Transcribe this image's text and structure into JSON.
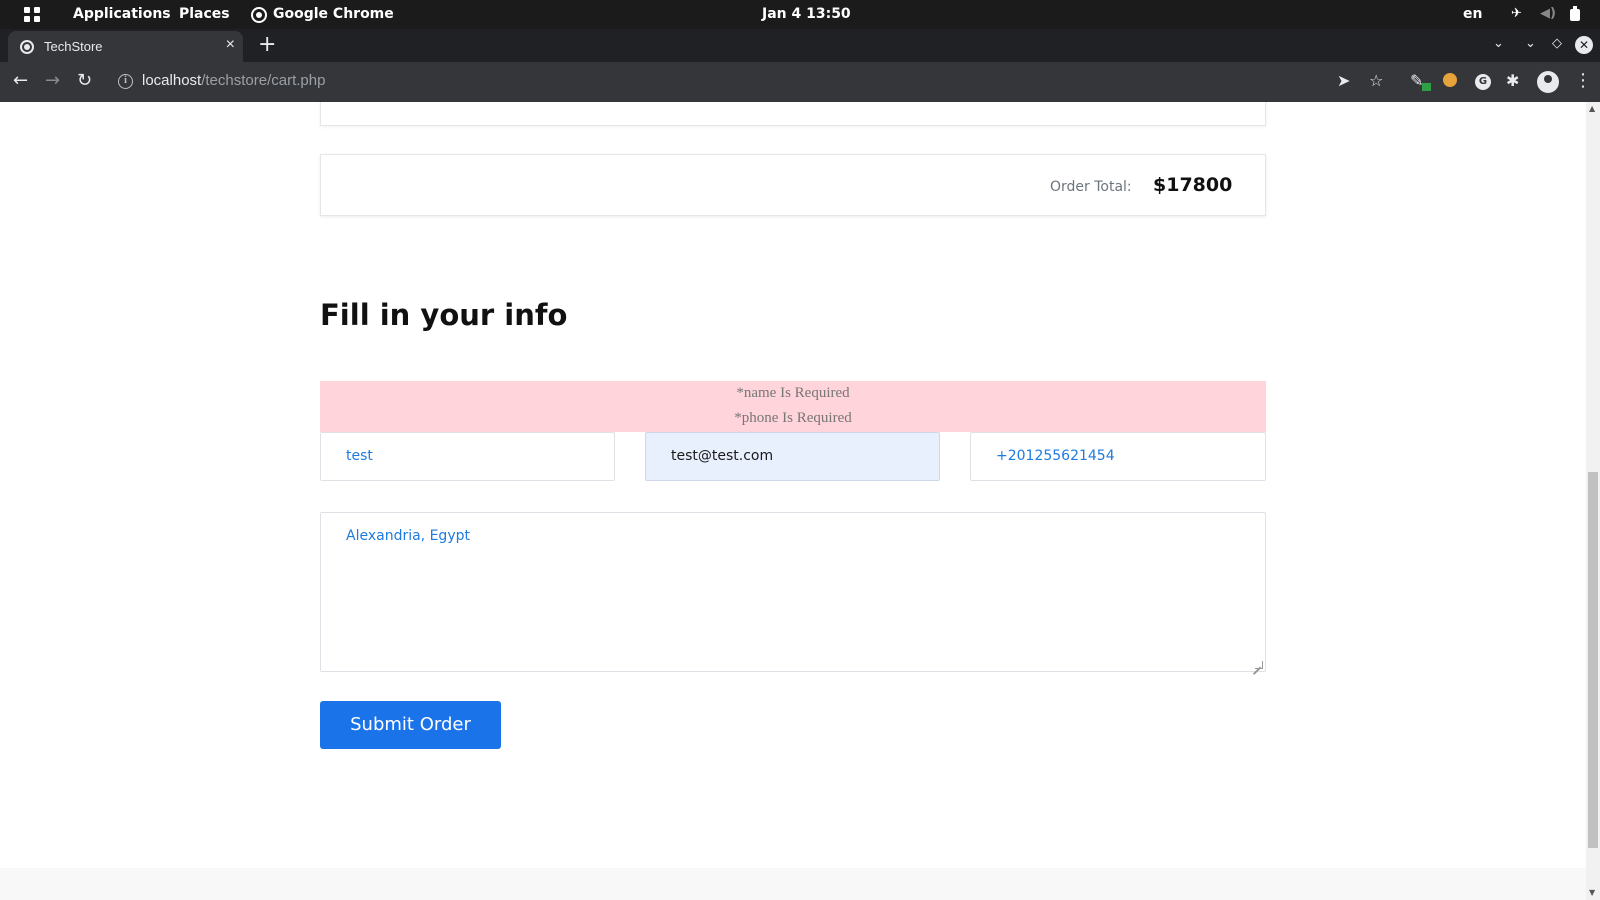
{
  "desktop": {
    "activities_icon": "app-grid-icon",
    "menu_applications": "Applications",
    "menu_places": "Places",
    "active_app": "Google Chrome",
    "clock": "Jan 4  13:50",
    "language": "en",
    "tray_icons": [
      "airplane-icon",
      "volume-icon",
      "battery-icon"
    ]
  },
  "browser": {
    "tab_title": "TechStore",
    "tab_close": "×",
    "new_tab": "+",
    "url_host": "localhost",
    "url_path": "/techstore/cart.php",
    "toolbar_icons": [
      "back-icon",
      "forward-icon",
      "reload-icon",
      "send-icon",
      "star-icon",
      "extension-icon",
      "puzzle-icon",
      "profile-icon",
      "menu-icon"
    ]
  },
  "page": {
    "order_total_label": "Order Total:",
    "order_total_value": "$17800",
    "section_title": "Fill in your info",
    "errors": [
      "*name Is Required",
      "*phone Is Required"
    ],
    "fields": {
      "name": "test",
      "email": "test@test.com",
      "phone": "+201255621454",
      "address": "Alexandria, Egypt"
    },
    "submit_label": "Submit Order"
  },
  "colors": {
    "accent": "#1a73e8",
    "alert_bg": "#ffd4da",
    "field_text": "#1e7be0",
    "autofill_bg": "#e8f0fe"
  }
}
